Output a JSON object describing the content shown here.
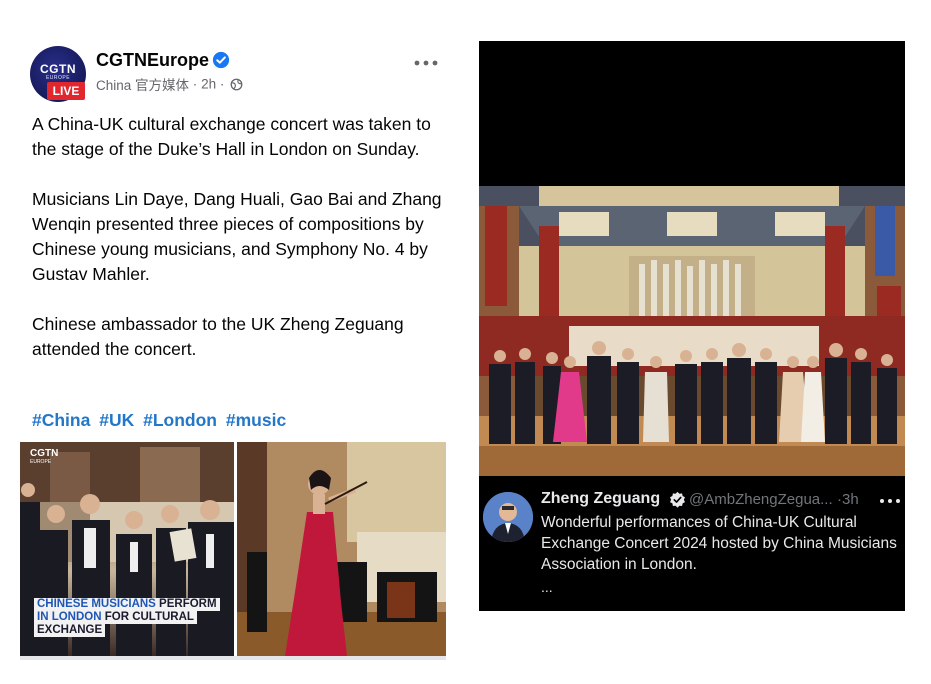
{
  "fb_post": {
    "page_name": "CGTNEurope",
    "avatar": {
      "brand": "CGTN",
      "sub": "EUROPE",
      "live_badge": "LIVE"
    },
    "meta": {
      "label": "China 官方媒体",
      "separator": "·",
      "time": "2h",
      "audience_icon": "globe-icon"
    },
    "paragraphs": [
      "A China-UK cultural exchange concert was taken to the stage of the Duke’s Hall in London on Sunday.",
      "Musicians Lin Daye, Dang Huali, Gao Bai and Zhang Wenqin presented three pieces of compositions by Chinese young musicians, and Symphony No. 4 by Gustav Mahler.",
      "Chinese ambassador to the UK Zheng Zeguang attended the concert."
    ],
    "hashtags": [
      "#China",
      "#UK",
      "#London",
      "#music"
    ],
    "media": {
      "left": {
        "logo": "CGTN",
        "logo_sub": "EUROPE",
        "caption_lines": [
          {
            "highlight": "CHINESE MUSICIANS",
            "rest": " PERFORM"
          },
          {
            "highlight": "IN LONDON",
            "rest": " FOR CULTURAL"
          },
          {
            "highlight": "",
            "rest": "EXCHANGE"
          }
        ]
      }
    }
  },
  "x_post": {
    "author_name": "Zheng Zeguang",
    "handle": "@AmbZhengZegua...",
    "separator": "·",
    "time": "3h",
    "text": "Wonderful performances of China-UK Cultural Exchange Concert 2024 hosted by China Musicians Association in London.",
    "truncation": "..."
  },
  "colors": {
    "hashtag": "#2377c9",
    "verified_fb": "#1877f2",
    "verified_x": "#e7e9ea",
    "live_badge": "#e1262e",
    "caption_highlight": "#1f56b5"
  }
}
